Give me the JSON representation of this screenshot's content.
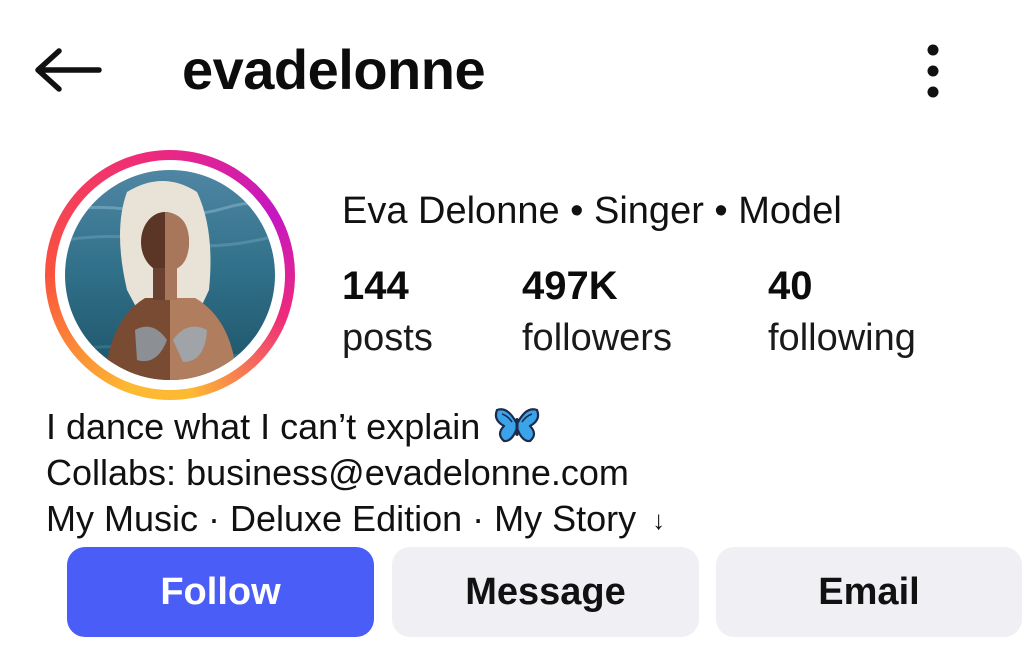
{
  "header": {
    "username": "evadelonne",
    "back_icon": "arrow-left-icon",
    "more_icon": "more-vertical-icon"
  },
  "profile": {
    "display_name": "Eva Delonne • Singer • Model",
    "avatar_ring_colors": [
      "#fdb932",
      "#f9533d",
      "#ee2a7b",
      "#c517c2"
    ],
    "stats": [
      {
        "value": "144",
        "label": "posts"
      },
      {
        "value": "497K",
        "label": "followers"
      },
      {
        "value": "40",
        "label": "following"
      }
    ]
  },
  "bio": {
    "line1": "I dance what I can’t explain",
    "line1_icon": "butterfly-emoji-icon",
    "line2": "Collabs: business@evadelonne.com",
    "line3": "My Music · Deluxe Edition · My Story",
    "line3_icon": "↓"
  },
  "actions": {
    "follow_label": "Follow",
    "message_label": "Message",
    "email_label": "Email",
    "follow_color": "#4a5ef7",
    "secondary_color": "#efeff4"
  }
}
